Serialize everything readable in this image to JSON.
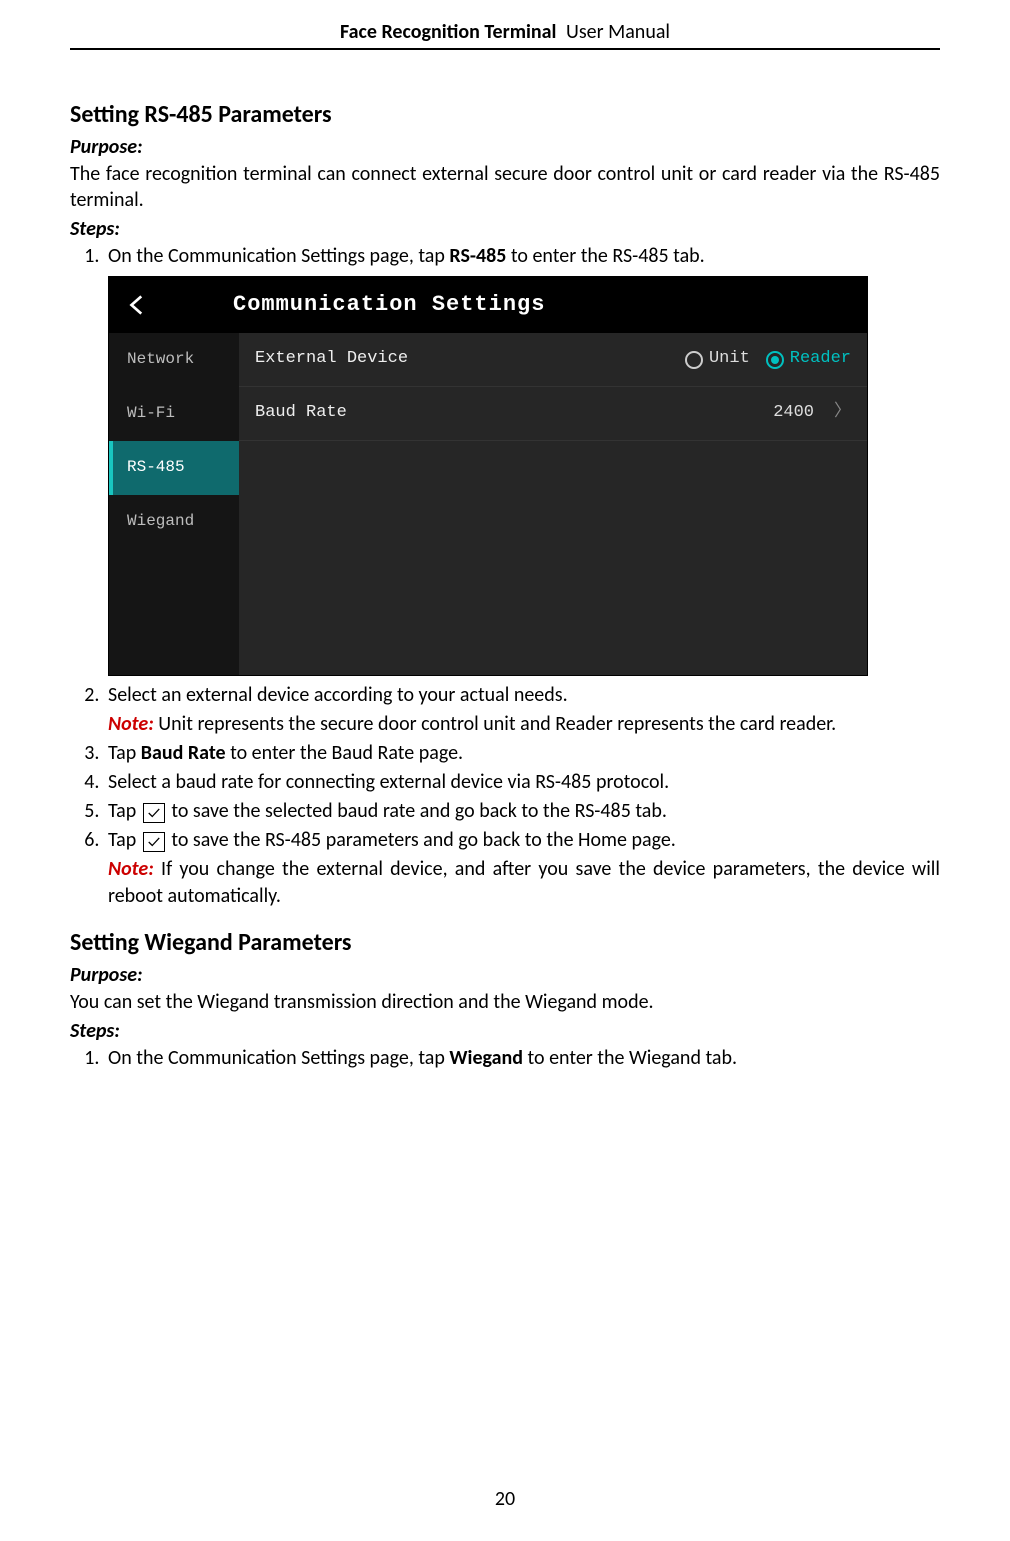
{
  "header": {
    "bold": "Face Recognition Terminal",
    "light": "User Manual"
  },
  "section1": {
    "title": "Setting RS-485 Parameters",
    "purpose_label": "Purpose:",
    "purpose_text": "The face recognition terminal can connect external secure door control unit or card reader via the RS-485 terminal.",
    "steps_label": "Steps:",
    "step1_a": "On the Communication Settings page, tap ",
    "step1_b": "RS-485",
    "step1_c": " to enter the RS-485 tab.",
    "step2": "Select an external device according to your actual needs.",
    "note1_label": "Note:",
    "note1_text": " Unit represents the secure door control unit and Reader represents the card reader.",
    "step3_a": "Tap ",
    "step3_b": "Baud Rate",
    "step3_c": " to enter the Baud Rate page.",
    "step4": "Select a baud rate for connecting external device via RS-485 protocol.",
    "step5_a": "Tap ",
    "step5_b": " to save the selected baud rate and go back to the RS-485 tab.",
    "step6_a": "Tap ",
    "step6_b": " to save the RS-485 parameters and go back to the Home page.",
    "note2_label": "Note:",
    "note2_text": " If you change the external device, and after you save the device parameters, the device will reboot automatically."
  },
  "shot": {
    "title": "Communication Settings",
    "side": [
      "Network",
      "Wi-Fi",
      "RS-485",
      "Wiegand"
    ],
    "row1_label": "External Device",
    "row1_opt1": "Unit",
    "row1_opt2": "Reader",
    "row2_label": "Baud Rate",
    "row2_value": "2400",
    "chev": "〉"
  },
  "section2": {
    "title": "Setting Wiegand Parameters",
    "purpose_label": "Purpose:",
    "purpose_text": "You can set the Wiegand transmission direction and the Wiegand mode.",
    "steps_label": "Steps:",
    "step1_a": "On the Communication Settings page, tap ",
    "step1_b": "Wiegand",
    "step1_c": " to enter the Wiegand tab."
  },
  "page_number": "20"
}
